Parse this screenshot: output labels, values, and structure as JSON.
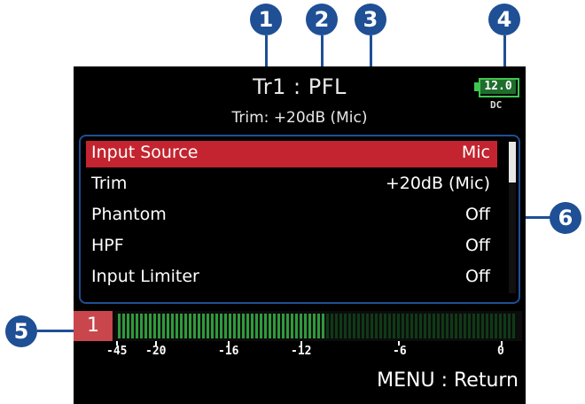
{
  "callouts": [
    "1",
    "2",
    "3",
    "4",
    "5",
    "6"
  ],
  "screen": {
    "title": "Tr1 : PFL",
    "subtitle": "Trim: +20dB (Mic)",
    "battery": {
      "value": "12.0",
      "source": "DC"
    },
    "menu": [
      {
        "label": "Input Source",
        "value": "Mic",
        "selected": true
      },
      {
        "label": "Trim",
        "value": "+20dB (Mic)"
      },
      {
        "label": "Phantom",
        "value": "Off"
      },
      {
        "label": "HPF",
        "value": "Off"
      },
      {
        "label": "Input Limiter",
        "value": "Off"
      }
    ],
    "channel": "1",
    "meter": {
      "level_fraction": 0.52,
      "scale": [
        "-45",
        "-20",
        "-16",
        "-12",
        "-6",
        "0"
      ]
    },
    "footer": "MENU : Return"
  },
  "colors": {
    "accent": "#1f4f95",
    "selected": "#c3242f",
    "meter_on": "#2f9a3c",
    "meter_off": "#0f3a16",
    "battery": "#3fc64f"
  }
}
